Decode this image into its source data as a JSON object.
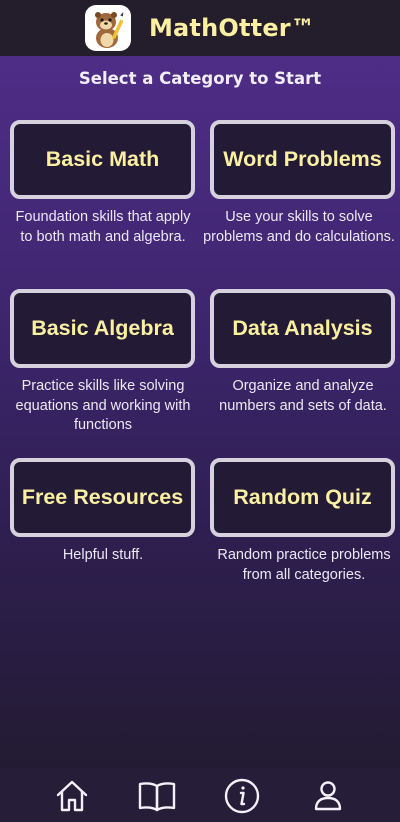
{
  "header": {
    "title": "MathOtter™",
    "logo_icon": "otter-mascot-icon"
  },
  "main": {
    "subtitle": "Select a Category to Start",
    "categories": [
      {
        "label": "Basic Math",
        "description": "Foundation skills that apply to both math and algebra."
      },
      {
        "label": "Word Problems",
        "description": "Use your skills to solve problems and do calculations."
      },
      {
        "label": "Basic Algebra",
        "description": "Practice skills like solving equations and working with functions"
      },
      {
        "label": "Data Analysis",
        "description": "Organize and analyze numbers and sets of data."
      },
      {
        "label": "Free Resources",
        "description": "Helpful stuff."
      },
      {
        "label": "Random Quiz",
        "description": "Random practice problems from all categories."
      }
    ]
  },
  "bottom_nav": {
    "items": [
      {
        "icon": "home-icon"
      },
      {
        "icon": "book-icon"
      },
      {
        "icon": "info-icon"
      },
      {
        "icon": "profile-icon"
      }
    ]
  },
  "colors": {
    "accent_yellow": "#fbf0a1",
    "header_bg": "#231d2c",
    "card_bg": "#231a35",
    "card_border": "#d5d2dd",
    "gradient_top": "#4e2d86"
  }
}
